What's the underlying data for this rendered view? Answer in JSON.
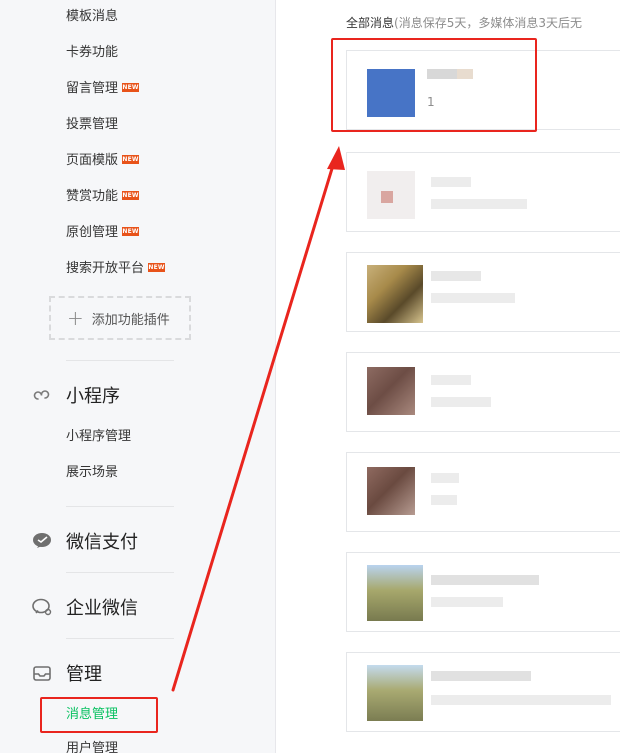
{
  "sidebar": {
    "feature_items": [
      {
        "label": "模板消息",
        "new": false
      },
      {
        "label": "卡券功能",
        "new": false
      },
      {
        "label": "留言管理",
        "new": true
      },
      {
        "label": "投票管理",
        "new": false
      },
      {
        "label": "页面模版",
        "new": true
      },
      {
        "label": "赞赏功能",
        "new": true
      },
      {
        "label": "原创管理",
        "new": true
      },
      {
        "label": "搜索开放平台",
        "new": true
      }
    ],
    "new_badge": "NEW",
    "add_plugin": {
      "plus": "+",
      "label": "添加功能插件"
    },
    "miniprogram": {
      "title": "小程序",
      "items": [
        "小程序管理",
        "展示场景"
      ]
    },
    "wechat_pay": {
      "title": "微信支付"
    },
    "wecom": {
      "title": "企业微信"
    },
    "manage": {
      "title": "管理",
      "items": [
        "消息管理",
        "用户管理"
      ]
    }
  },
  "main": {
    "hint_prefix": "全部消息",
    "hint_detail": "(消息保存5天，多媒体消息3天后无",
    "first_message": {
      "count": "1"
    }
  },
  "colors": {
    "accent": "#07c160",
    "annotation": "#e9251e",
    "new_badge": "#e8531a"
  }
}
